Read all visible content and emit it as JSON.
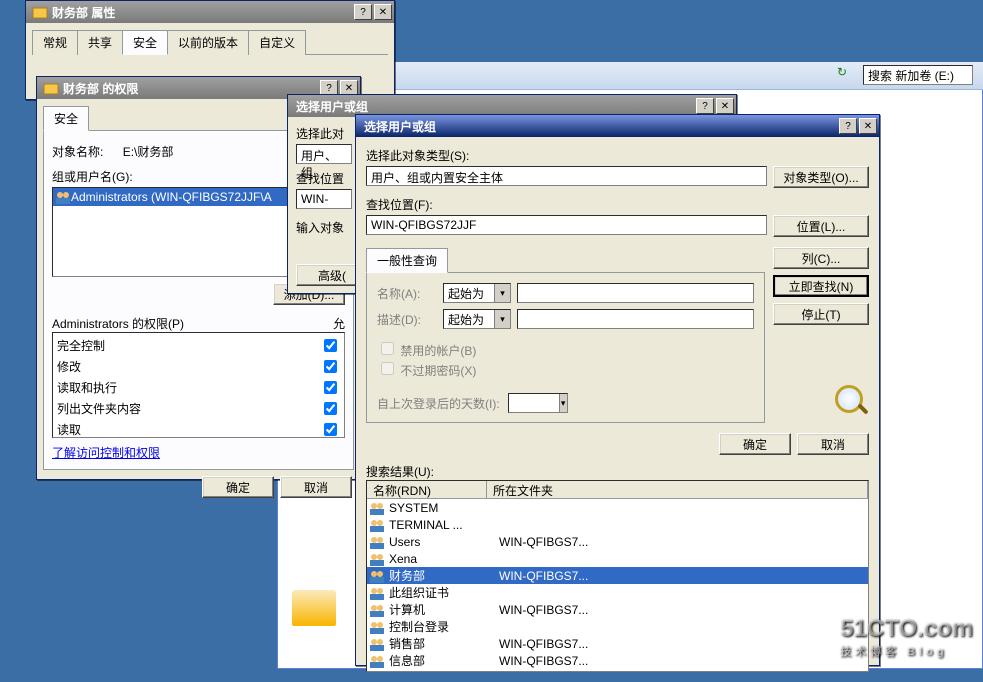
{
  "win1": {
    "title": "财务部 属性",
    "tabs": [
      "常规",
      "共享",
      "安全",
      "以前的版本",
      "自定义"
    ],
    "active_tab": "安全"
  },
  "win2": {
    "title": "财务部 的权限",
    "tab": "安全",
    "obj_label": "对象名称:",
    "obj_value": "E:\\财务部",
    "groups_label": "组或用户名(G):",
    "group_entry": "Administrators (WIN-QFIBGS72JJF\\A",
    "add_btn": "添加(D)...",
    "perm_header": "Administrators 的权限(P)",
    "perm_allow": "允",
    "perms": [
      "完全控制",
      "修改",
      "读取和执行",
      "列出文件夹内容",
      "读取"
    ],
    "link": "了解访问控制和权限",
    "ok": "确定",
    "cancel": "取消"
  },
  "win3": {
    "title": "选择用户或组",
    "sel_obj": "选择此对",
    "usergrp": "用户、组",
    "find_loc": "查找位置",
    "win_name": "WIN-",
    "enter_obj": "输入对象",
    "advanced": "高级(",
    "fields_col1": [
      "选择此对象类型(S):",
      "查找位置(F):"
    ],
    "field_user": "用户、组或内置安全主体",
    "field_win": "WIN-QFIBGS72JJF",
    "obj_type_btn": "对象类型(O)...",
    "loc_btn": "位置(L)...",
    "ok": "确定",
    "cancel": "取消"
  },
  "win4": {
    "title": "选择用户或组",
    "sel_type_lbl": "选择此对象类型(S):",
    "sel_type_val": "用户、组或内置安全主体",
    "obj_type_btn": "对象类型(O)...",
    "find_loc_lbl": "查找位置(F):",
    "find_loc_val": "WIN-QFIBGS72JJF",
    "loc_btn": "位置(L)...",
    "general_query": "一般性查询",
    "name_lbl": "名称(A):",
    "desc_lbl": "描述(D):",
    "starts_with": "起始为",
    "disabled_acct": "禁用的帐户(B)",
    "no_expire": "不过期密码(X)",
    "days_since": "自上次登录后的天数(I):",
    "columns_btn": "列(C)...",
    "find_now_btn": "立即查找(N)",
    "stop_btn": "停止(T)",
    "ok": "确定",
    "cancel": "取消",
    "results_lbl": "搜索结果(U):",
    "col_name": "名称(RDN)",
    "col_folder": "所在文件夹",
    "results": [
      {
        "name": "SYSTEM",
        "folder": ""
      },
      {
        "name": "TERMINAL ...",
        "folder": ""
      },
      {
        "name": "Users",
        "folder": "WIN-QFIBGS7..."
      },
      {
        "name": "Xena",
        "folder": ""
      },
      {
        "name": "财务部",
        "folder": "WIN-QFIBGS7...",
        "selected": true
      },
      {
        "name": "此组织证书",
        "folder": ""
      },
      {
        "name": "计算机",
        "folder": "WIN-QFIBGS7..."
      },
      {
        "name": "控制台登录",
        "folder": ""
      },
      {
        "name": "销售部",
        "folder": "WIN-QFIBGS7..."
      },
      {
        "name": "信息部",
        "folder": "WIN-QFIBGS7..."
      }
    ]
  },
  "explorer": {
    "search": "搜索 新加卷 (E:)"
  },
  "watermark": {
    "main": "51CTO.com",
    "sub": "技术博客  Blog"
  }
}
